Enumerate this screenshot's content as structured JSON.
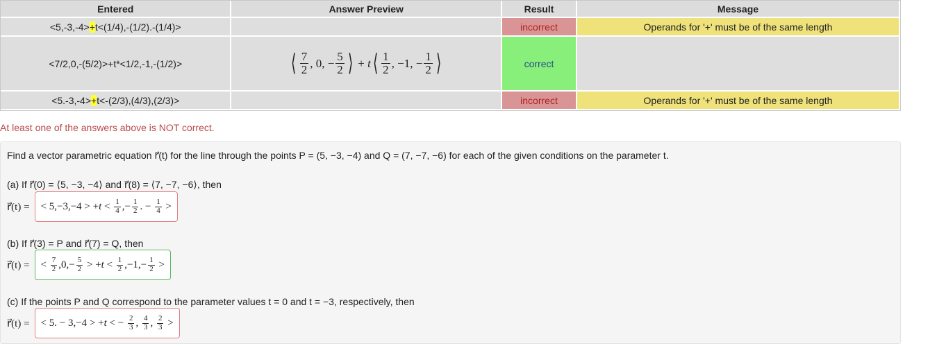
{
  "table": {
    "headers": [
      "Entered",
      "Answer Preview",
      "Result",
      "Message"
    ],
    "rows": [
      {
        "entered_pre": "<5,-3,-4>",
        "entered_hl": "+",
        "entered_post": "t<(1/4),-(1/2).-(1/4)>",
        "result": "incorrect",
        "message": "Operands for '+' must be of the same length"
      },
      {
        "entered": "<7/2,0,-(5/2)>+t*<1/2,-1,-(1/2)>",
        "result": "correct",
        "message": ""
      },
      {
        "entered_pre": "<5.-3,-4>",
        "entered_hl": "+",
        "entered_post": "t<-(2/3),(4/3),(2/3)>",
        "result": "incorrect",
        "message": "Operands for '+' must be of the same length"
      }
    ]
  },
  "status_message": "At least one of the answers above is NOT correct.",
  "problem": {
    "statement": "Find a vector parametric equation r⃗(t) for the line through the points P = (5, −3, −4) and Q = (7, −7, −6) for each of the given conditions on the parameter t.",
    "part_a": "(a) If r⃗(0) = ⟨5, −3, −4⟩ and r⃗(8) = ⟨7, −7, −6⟩, then",
    "part_b": "(b) If r⃗(3) = P and r⃗(7) = Q, then",
    "part_c": "(c) If the points P and Q correspond to the parameter values t = 0 and t = −3, respectively, then",
    "r_label": "r⃗(t) ="
  },
  "colors": {
    "incorrect": "#d99595",
    "correct": "#88f07a",
    "warning": "#efe27a",
    "highlight": "#ffff33"
  }
}
